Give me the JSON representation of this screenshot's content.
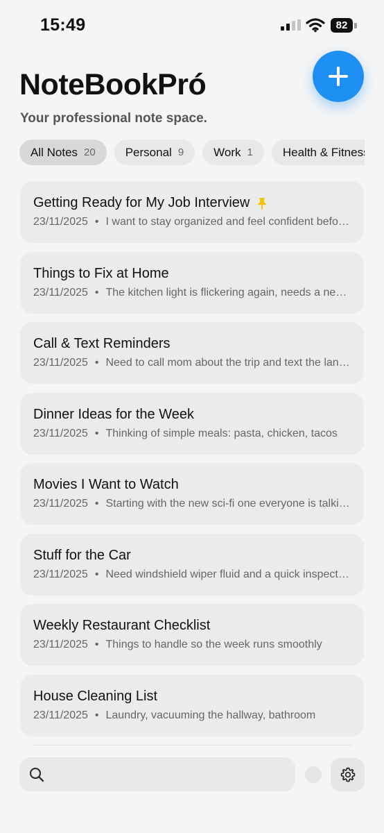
{
  "status": {
    "time": "15:49",
    "battery": "82"
  },
  "app": {
    "title": "NoteBookPró",
    "subtitle": "Your professional note space."
  },
  "chips": [
    {
      "label": "All Notes",
      "count": "20"
    },
    {
      "label": "Personal",
      "count": "9"
    },
    {
      "label": "Work",
      "count": "1"
    },
    {
      "label": "Health & Fitness",
      "count": ""
    }
  ],
  "notes": [
    {
      "title": "Getting Ready for My Job Interview",
      "date": "23/11/2025",
      "preview": "I want to stay organized and feel confident before the interview",
      "pinned": true
    },
    {
      "title": "Things to Fix at Home",
      "date": "23/11/2025",
      "preview": "The kitchen light is flickering again, needs a new bulb"
    },
    {
      "title": "Call & Text Reminders",
      "date": "23/11/2025",
      "preview": "Need to call mom about the trip and text the landlord"
    },
    {
      "title": "Dinner Ideas for the Week",
      "date": "23/11/2025",
      "preview": "Thinking of simple meals: pasta, chicken, tacos"
    },
    {
      "title": "Movies I Want to Watch",
      "date": "23/11/2025",
      "preview": "Starting with the new sci-fi one everyone is talking about"
    },
    {
      "title": "Stuff for the Car",
      "date": "23/11/2025",
      "preview": "Need windshield wiper fluid and a quick inspection"
    },
    {
      "title": "Weekly Restaurant Checklist",
      "date": "23/11/2025",
      "preview": "Things to handle so the week runs smoothly"
    },
    {
      "title": "House Cleaning List",
      "date": "23/11/2025",
      "preview": "Laundry, vacuuming the hallway, bathroom"
    }
  ],
  "search": {
    "placeholder": ""
  },
  "colors": {
    "accent": "#1e90f3",
    "pin": "#f5c400",
    "card": "#ebebeb",
    "background": "#f5f5f5"
  }
}
